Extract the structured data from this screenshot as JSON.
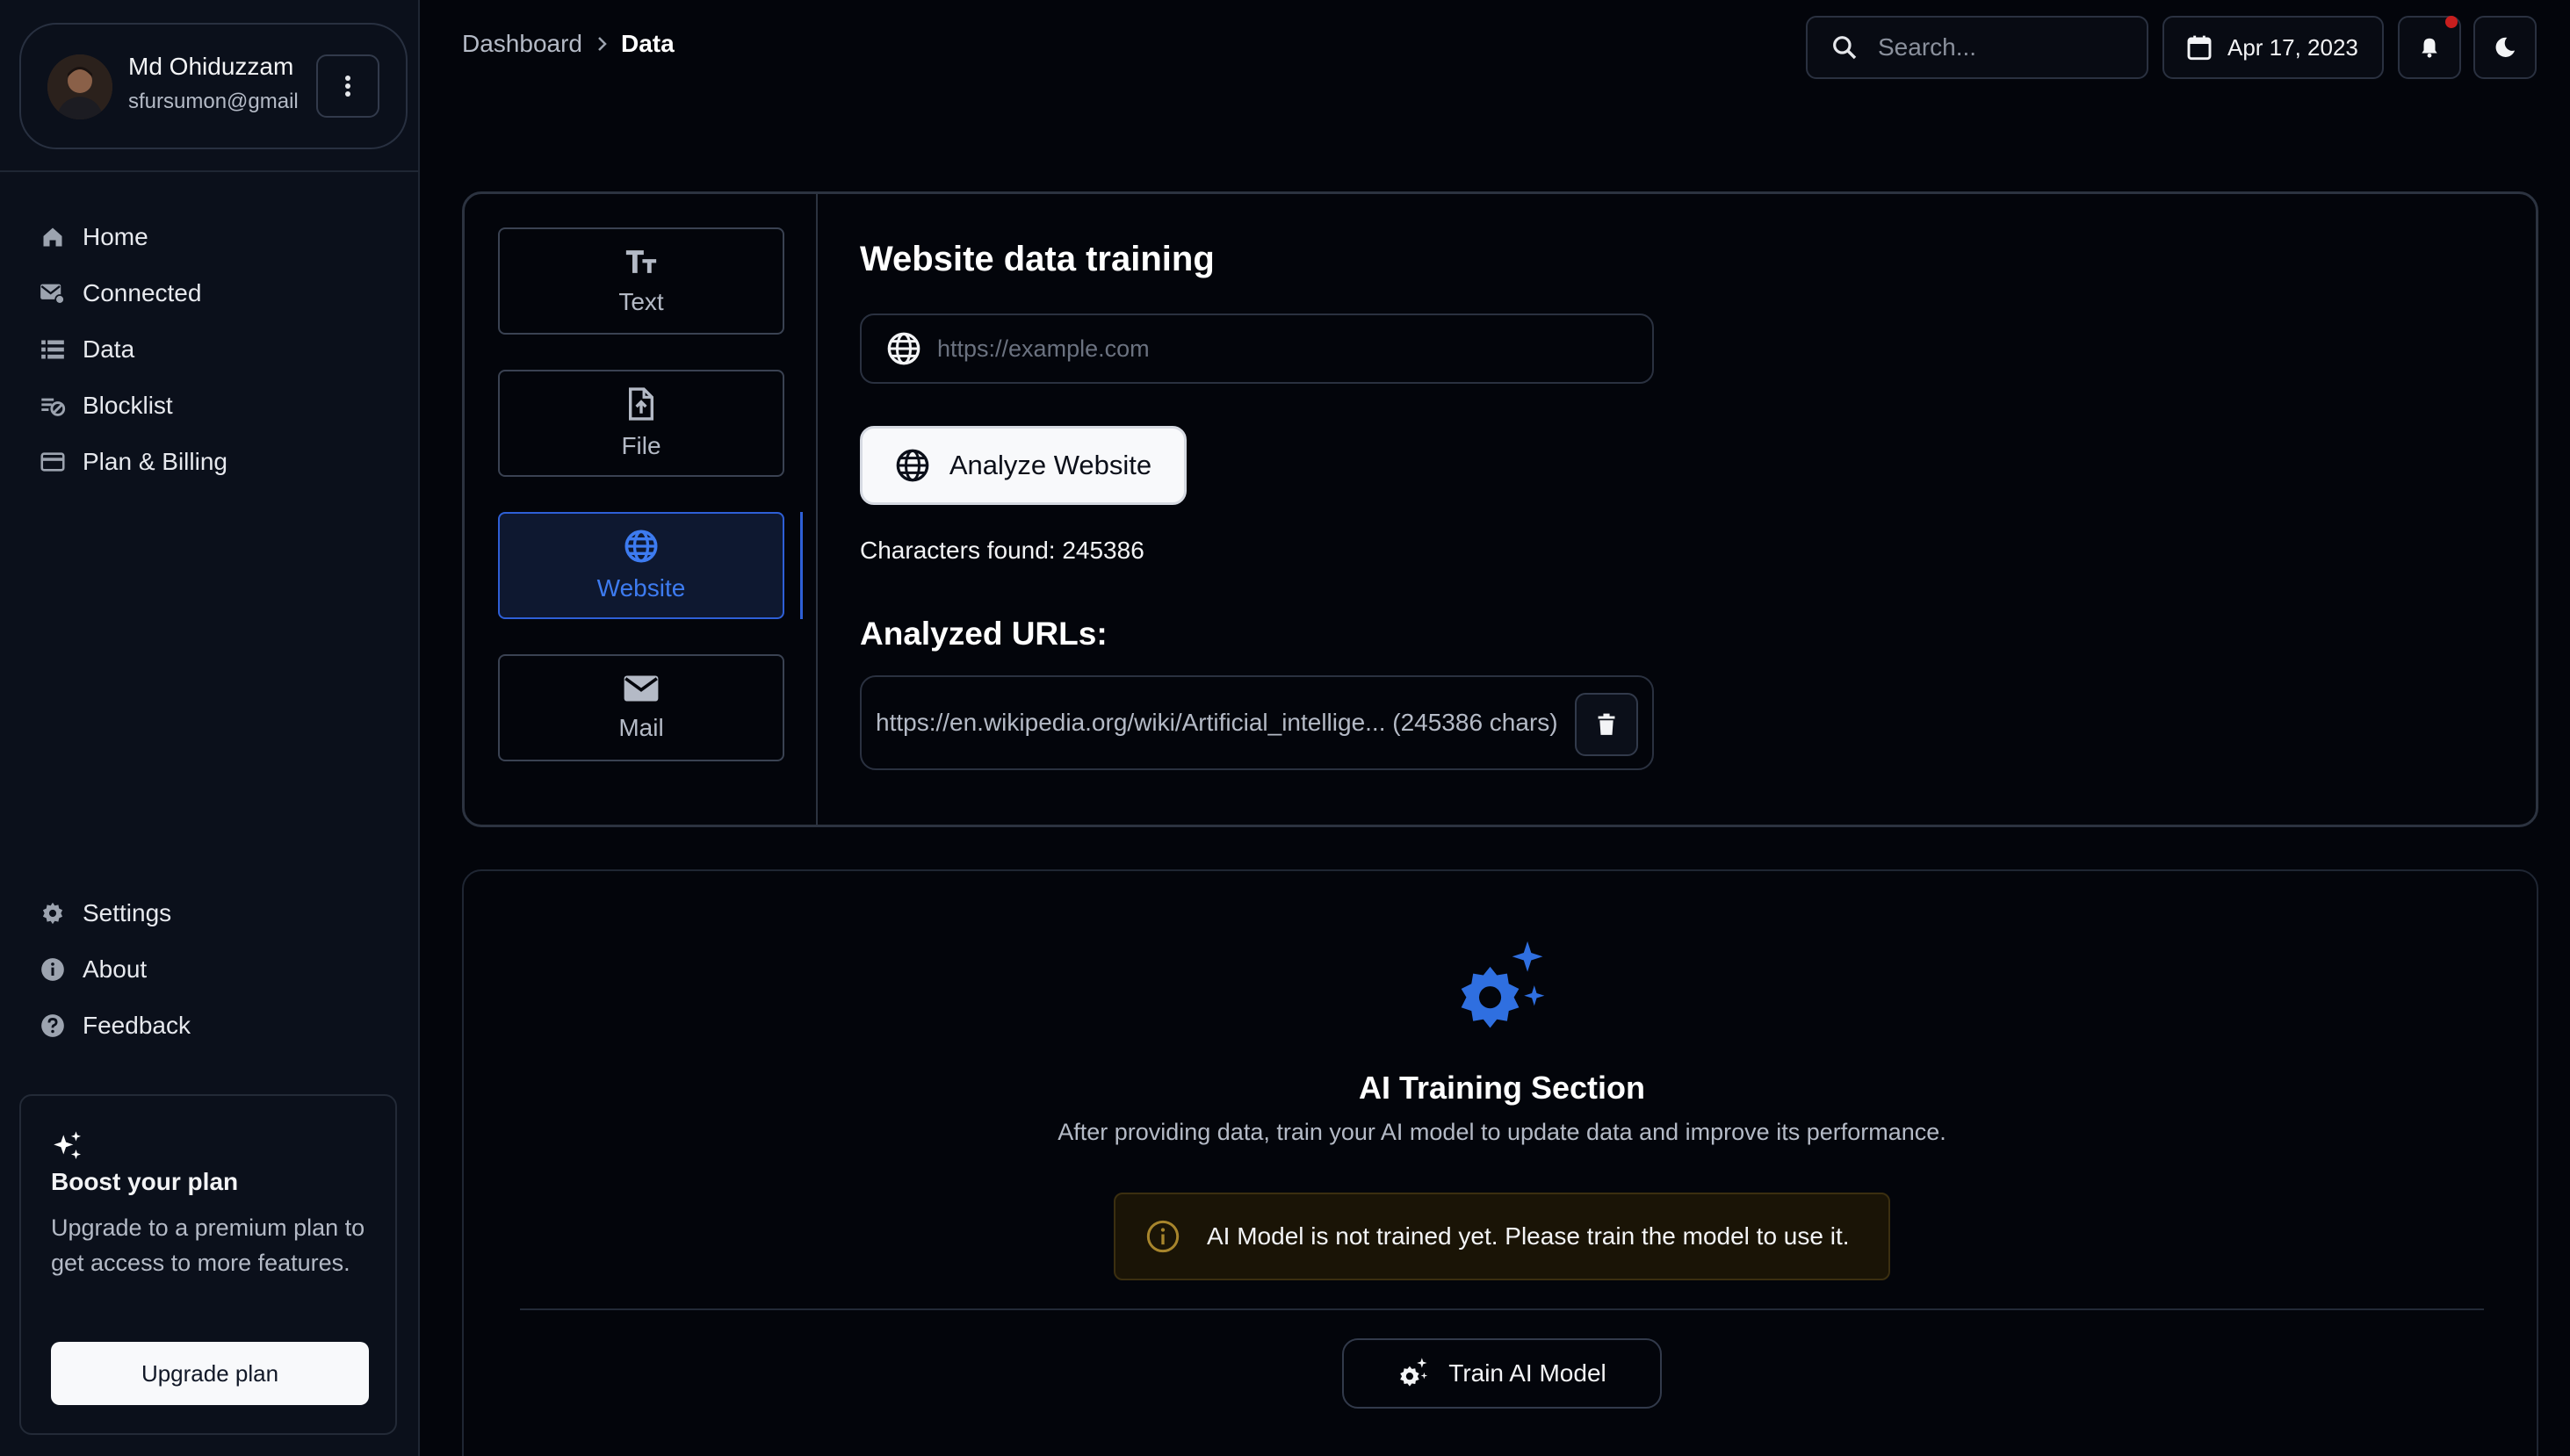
{
  "user": {
    "name": "Md Ohiduzzam",
    "email": "sfursumon@gmail"
  },
  "sidebar": {
    "nav_top": [
      {
        "label": "Home",
        "icon": "home-icon"
      },
      {
        "label": "Connected",
        "icon": "connected-mail-icon"
      },
      {
        "label": "Data",
        "icon": "data-list-icon"
      },
      {
        "label": "Blocklist",
        "icon": "blocklist-icon"
      },
      {
        "label": "Plan & Billing",
        "icon": "credit-card-icon"
      }
    ],
    "nav_bottom": [
      {
        "label": "Settings",
        "icon": "gear-icon"
      },
      {
        "label": "About",
        "icon": "info-icon"
      },
      {
        "label": "Feedback",
        "icon": "help-icon"
      }
    ],
    "boost": {
      "title": "Boost your plan",
      "text": "Upgrade to a premium plan to get access to more features.",
      "button": "Upgrade plan"
    }
  },
  "header": {
    "breadcrumb": [
      "Dashboard",
      "Data"
    ],
    "search_placeholder": "Search...",
    "date": "Apr 17, 2023"
  },
  "training": {
    "tabs": [
      {
        "label": "Text",
        "icon": "text-size-icon",
        "active": false
      },
      {
        "label": "File",
        "icon": "file-upload-icon",
        "active": false
      },
      {
        "label": "Website",
        "icon": "globe-icon",
        "active": true
      },
      {
        "label": "Mail",
        "icon": "mail-icon",
        "active": false
      }
    ],
    "title": "Website data training",
    "url_placeholder": "https://example.com",
    "analyze_button": "Analyze Website",
    "characters_found": "Characters found: 245386",
    "analyzed_title": "Analyzed URLs:",
    "analyzed_urls": [
      {
        "text": "https://en.wikipedia.org/wiki/Artificial_intellige... (245386 chars)"
      }
    ]
  },
  "ai_section": {
    "title": "AI Training Section",
    "description": "After providing data, train your AI model to update data and improve its performance.",
    "alert": "AI Model is not trained yet. Please train the model to use it.",
    "train_button": "Train AI Model"
  },
  "colors": {
    "accent": "#2e6fe0",
    "background": "#03050b",
    "sidebar": "#0b101b",
    "alert_bg": "#1a1406",
    "notification_dot": "#c81e1e"
  }
}
